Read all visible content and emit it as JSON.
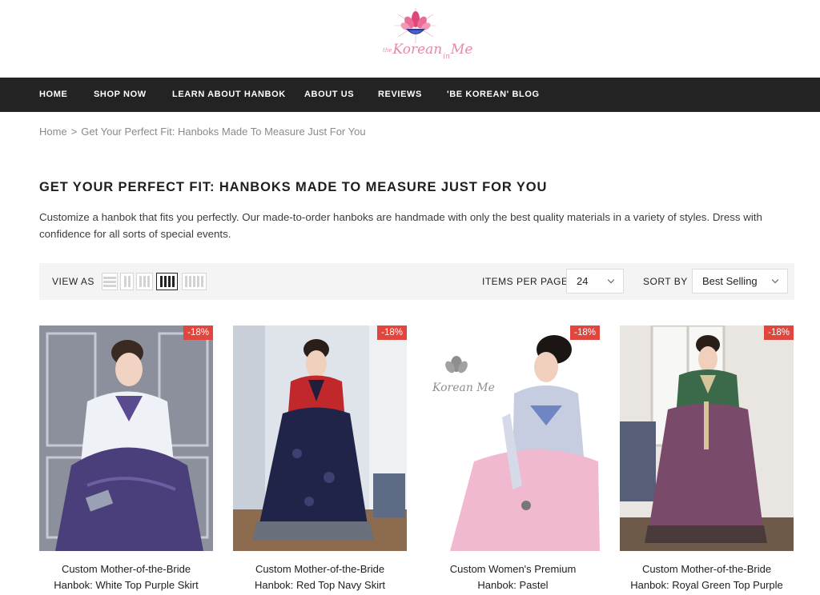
{
  "logo": {
    "brand_small": "the",
    "brand_word1": "Korean",
    "brand_word2": "in",
    "brand_word3": "Me"
  },
  "nav": [
    {
      "label": "HOME"
    },
    {
      "label": "SHOP NOW"
    },
    {
      "label": "LEARN ABOUT HANBOK"
    },
    {
      "label": "ABOUT US"
    },
    {
      "label": "REVIEWS"
    },
    {
      "label": "'BE KOREAN' BLOG"
    }
  ],
  "breadcrumb": {
    "home": "Home",
    "separator": ">",
    "current": "Get Your Perfect Fit: Hanboks Made To Measure Just For You"
  },
  "page": {
    "title": "GET YOUR PERFECT FIT: HANBOKS MADE TO MEASURE JUST FOR YOU",
    "description": "Customize a hanbok that fits you perfectly. Our made-to-order hanboks are handmade with only the best quality materials in a variety of styles. Dress with confidence for all sorts of special events."
  },
  "toolbar": {
    "view_as_label": "VIEW AS",
    "view_options": [
      "list",
      "2-columns",
      "3-columns",
      "4-columns",
      "5-columns"
    ],
    "active_view": "4-columns",
    "items_per_page_label": "ITEMS PER PAGE",
    "items_per_page_value": "24",
    "sort_by_label": "SORT BY",
    "sort_by_value": "Best Selling"
  },
  "products": [
    {
      "title_line1": "Custom Mother-of-the-Bride",
      "title_line2": "Hanbok: White Top Purple Skirt",
      "badge": "-18%",
      "image": "woman in white jeogori and purple chima"
    },
    {
      "title_line1": "Custom Mother-of-the-Bride",
      "title_line2": "Hanbok: Red Top Navy Skirt",
      "badge": "-18%",
      "image": "woman in red jeogori and navy chima"
    },
    {
      "title_line1": "Custom Women's Premium",
      "title_line2": "Hanbok: Pastel",
      "badge": "-18%",
      "image": "woman in pastel hanbok sitting, watermark logo"
    },
    {
      "title_line1": "Custom Mother-of-the-Bride",
      "title_line2": "Hanbok: Royal Green Top Purple",
      "badge": "-18%",
      "image": "woman in green jeogori and purple chima"
    }
  ],
  "colors": {
    "nav_bg": "#232323",
    "badge_bg": "#e0463e",
    "toolbar_bg": "#f4f4f4",
    "logo_pink": "#e58aa6"
  }
}
